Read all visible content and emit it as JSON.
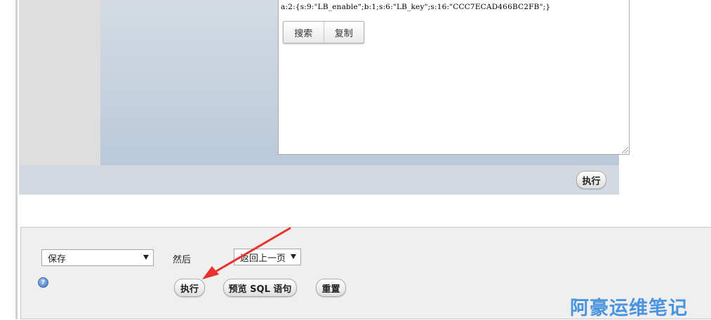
{
  "sql_box": {
    "code": "a:2:{s:9:\"LB_enable\";b:1;s:6:\"LB_key\";s:16:\"CCC7ECAD466BC2FB\";}",
    "search_label": "搜索",
    "copy_label": "复制"
  },
  "upper": {
    "execute_label": "执行"
  },
  "form": {
    "action_select": "保存",
    "then_label": "然后",
    "after_select": "返回上一页",
    "execute_label": "执行",
    "preview_label": "预览 SQL 语句",
    "reset_label": "重置",
    "help_icon_glyph": "?"
  },
  "annotation": {
    "arrow_color": "#e8322b"
  },
  "watermark": {
    "text": "阿豪运维笔记"
  }
}
